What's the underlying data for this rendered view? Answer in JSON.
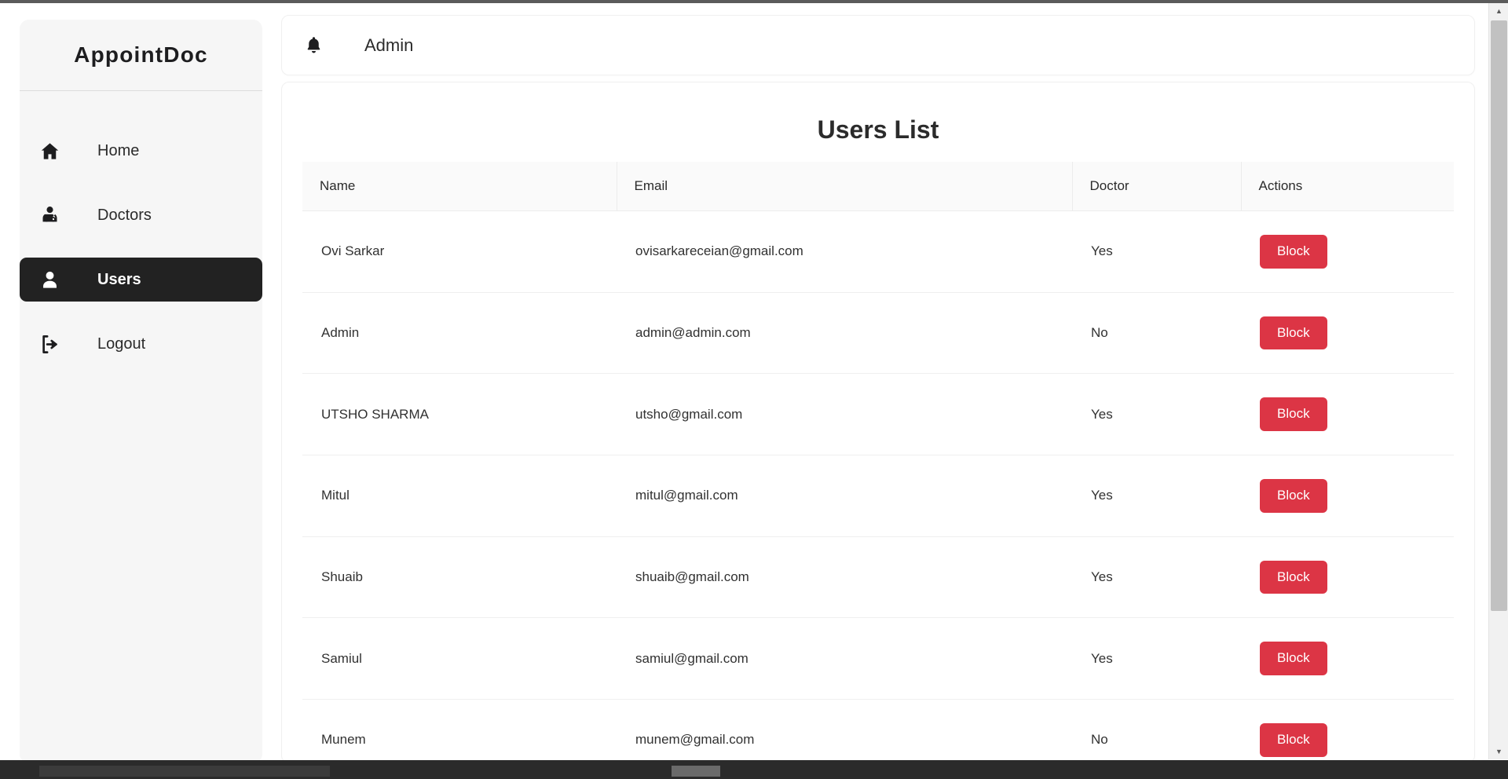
{
  "app": {
    "brand": "AppointDoc"
  },
  "sidebar": {
    "items": [
      {
        "label": "Home",
        "icon": "home-icon",
        "active": false
      },
      {
        "label": "Doctors",
        "icon": "doctor-icon",
        "active": false
      },
      {
        "label": "Users",
        "icon": "user-icon",
        "active": true
      },
      {
        "label": "Logout",
        "icon": "logout-icon",
        "active": false
      }
    ]
  },
  "header": {
    "notification_icon": "bell-icon",
    "title": "Admin"
  },
  "main": {
    "page_title": "Users List",
    "table": {
      "columns": [
        "Name",
        "Email",
        "Doctor",
        "Actions"
      ],
      "rows": [
        {
          "name": "Ovi Sarkar",
          "email": "ovisarkareceian@gmail.com",
          "doctor": "Yes",
          "action": "Block"
        },
        {
          "name": "Admin",
          "email": "admin@admin.com",
          "doctor": "No",
          "action": "Block"
        },
        {
          "name": "UTSHO SHARMA",
          "email": "utsho@gmail.com",
          "doctor": "Yes",
          "action": "Block"
        },
        {
          "name": "Mitul",
          "email": "mitul@gmail.com",
          "doctor": "Yes",
          "action": "Block"
        },
        {
          "name": "Shuaib",
          "email": "shuaib@gmail.com",
          "doctor": "Yes",
          "action": "Block"
        },
        {
          "name": "Samiul",
          "email": "samiul@gmail.com",
          "doctor": "Yes",
          "action": "Block"
        },
        {
          "name": "Munem",
          "email": "munem@gmail.com",
          "doctor": "No",
          "action": "Block"
        }
      ]
    }
  },
  "colors": {
    "danger": "#dc3545",
    "sidebar_bg": "#f6f6f6",
    "active_nav_bg": "#222222",
    "text": "#2b2b2b"
  }
}
